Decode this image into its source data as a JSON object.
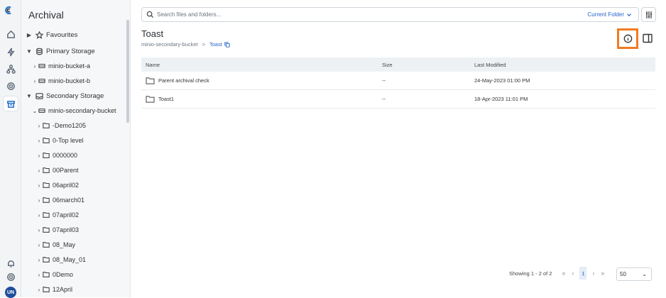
{
  "rail": {
    "icons": [
      "home-icon",
      "bolt-icon",
      "hierarchy-icon",
      "gear-icon",
      "archive-icon"
    ],
    "bottom_icons": [
      "bell-icon",
      "settings-icon"
    ],
    "avatar": "UN"
  },
  "tree": {
    "title": "Archival",
    "favourites": "Favourites",
    "primary_storage": "Primary Storage",
    "primary_buckets": [
      "minio-bucket-a",
      "minio-bucket-b"
    ],
    "secondary_storage": "Secondary Storage",
    "secondary_bucket": "minio-secondary-bucket",
    "folders": [
      "-Demo1205",
      "0-Top level",
      "0000000",
      "00Parent",
      "06april02",
      "06march01",
      "07april02",
      "07april03",
      "08_May",
      "08_May_01",
      "0Demo",
      "12April"
    ]
  },
  "search": {
    "placeholder": "Search files and folders...",
    "scope": "Current Folder"
  },
  "page": {
    "title": "Toast",
    "breadcrumb_root": "minio-secondary-bucket",
    "breadcrumb_sep": ">",
    "breadcrumb_current": "Toast"
  },
  "table": {
    "headers": {
      "name": "Name",
      "size": "Size",
      "modified": "Last Modified"
    },
    "rows": [
      {
        "name": "Parent archival check",
        "size": "--",
        "modified": "24-May-2023 01:00 PM"
      },
      {
        "name": "Toast1",
        "size": "--",
        "modified": "18-Apr-2023 11:01 PM"
      }
    ]
  },
  "pagination": {
    "showing": "Showing 1 - 2 of 2",
    "first": "«",
    "prev": "‹",
    "page": "1",
    "next": "›",
    "last": "»",
    "page_size": "50"
  },
  "colors": {
    "accent": "#2563c9",
    "highlight": "#f07b24",
    "avatar": "#1f4e9c"
  }
}
